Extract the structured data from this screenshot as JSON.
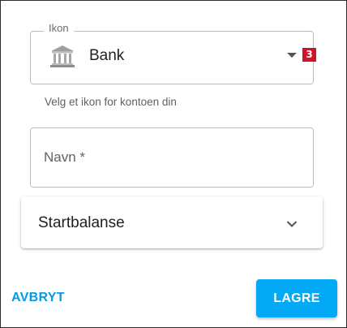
{
  "icon_field": {
    "legend": "Ikon",
    "value": "Bank",
    "icon": "bank-icon",
    "helper": "Velg et ikon for kontoen din",
    "badge": "3"
  },
  "name_field": {
    "label": "Navn *"
  },
  "start_balance": {
    "label": "Startbalanse",
    "icon": "chevron-down-icon"
  },
  "actions": {
    "cancel_label": "AVBRYT",
    "save_label": "LAGRE"
  },
  "colors": {
    "accent": "#03a9f4",
    "link": "#039be5",
    "badge": "#d0122b"
  }
}
